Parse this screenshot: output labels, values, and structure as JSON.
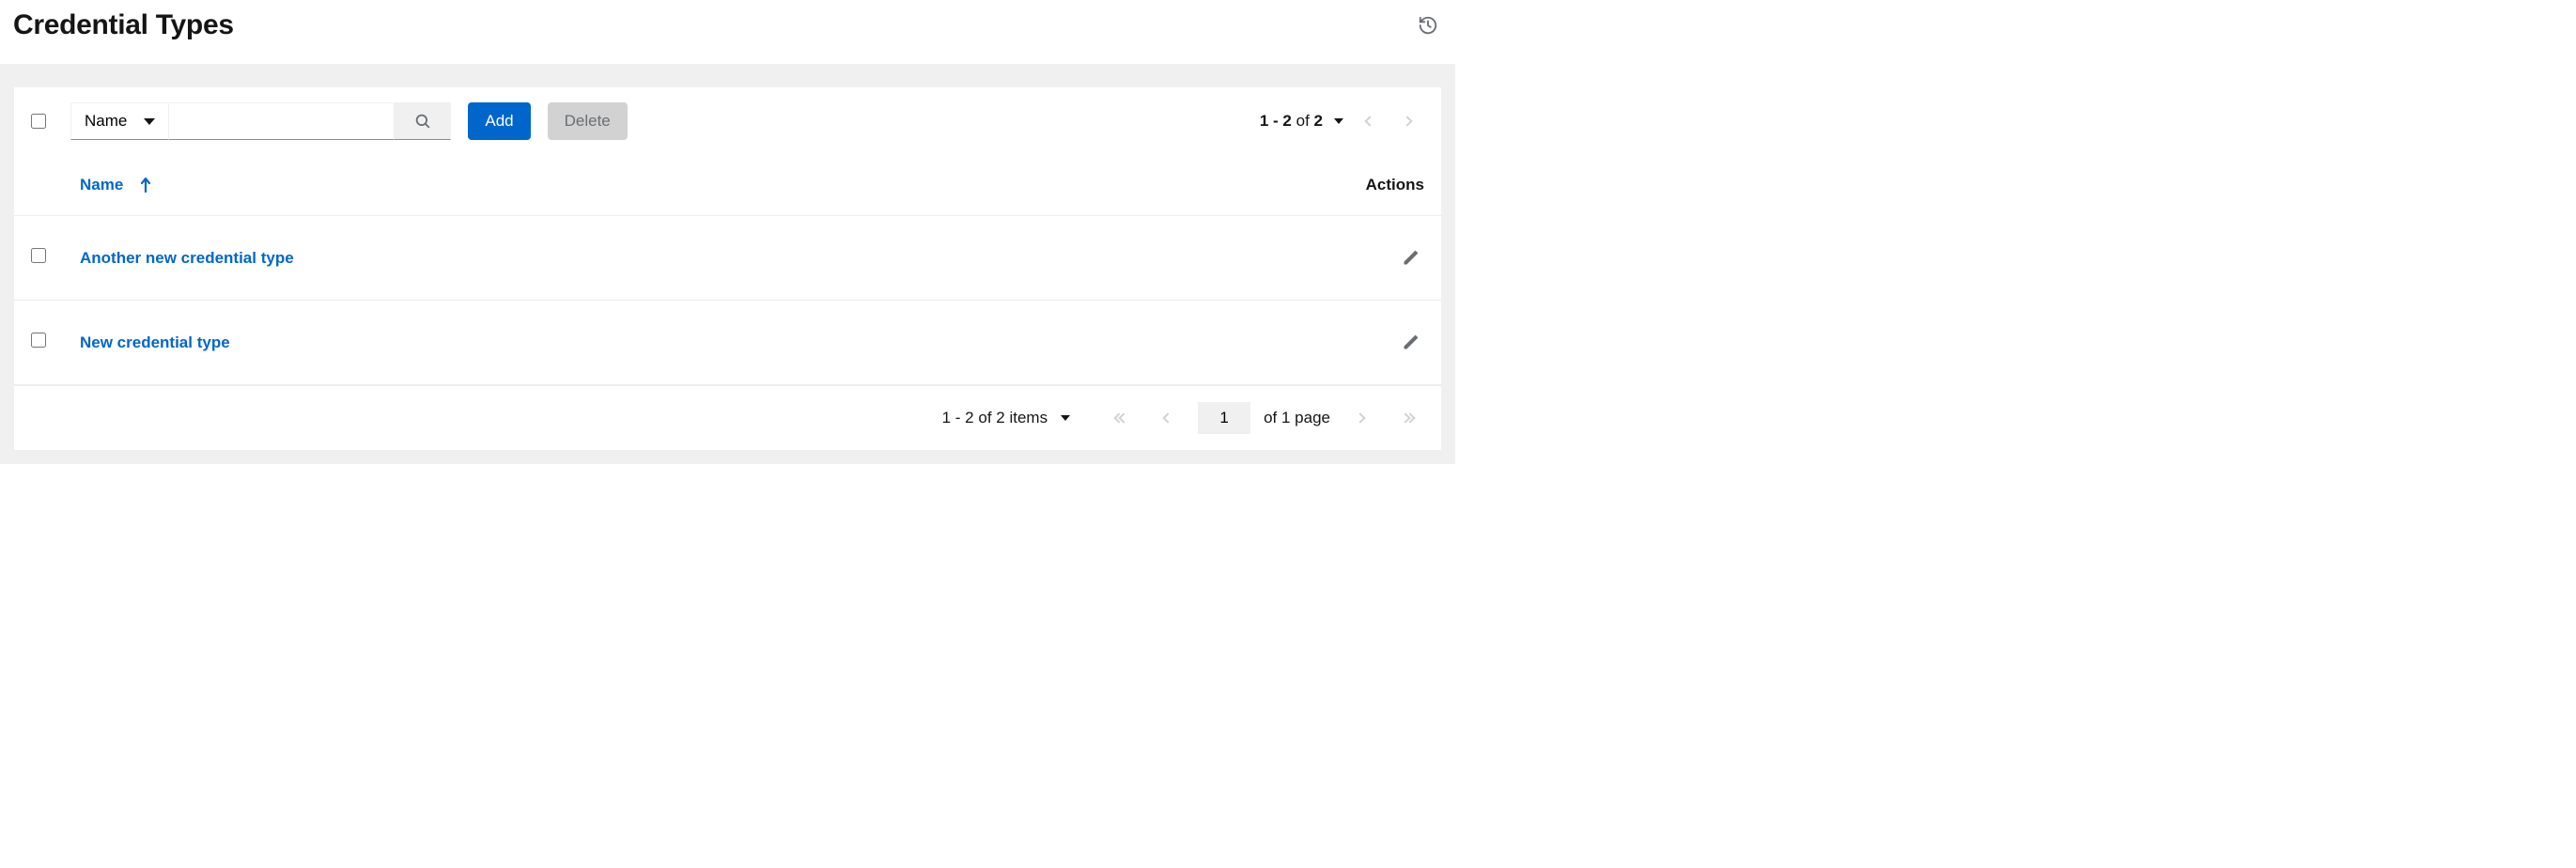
{
  "page": {
    "title": "Credential Types"
  },
  "toolbar": {
    "filter_attr": "Name",
    "search_value": "",
    "add_label": "Add",
    "delete_label": "Delete"
  },
  "pagination_top": {
    "range": "1 - 2",
    "of_label": "of",
    "total": "2"
  },
  "table": {
    "columns": {
      "name": "Name",
      "actions": "Actions"
    },
    "rows": [
      {
        "name": "Another new credential type"
      },
      {
        "name": "New credential type"
      }
    ]
  },
  "pagination_bottom": {
    "range": "1 - 2",
    "of_label": "of",
    "total_items": "2 items",
    "page_value": "1",
    "page_suffix": "of 1 page"
  }
}
